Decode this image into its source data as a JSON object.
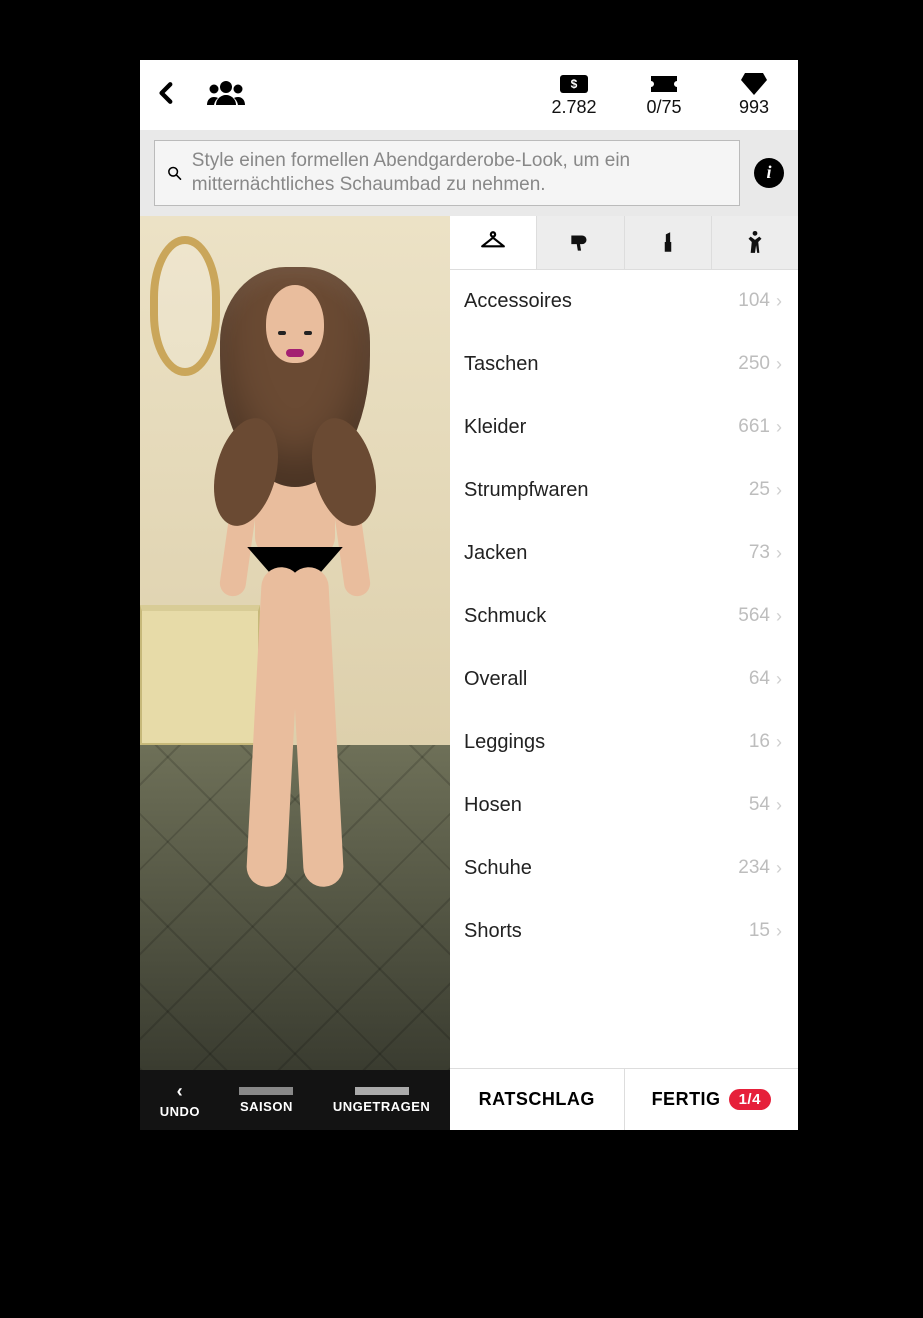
{
  "topbar": {
    "cash": "2.782",
    "tickets": "0/75",
    "gems": "993"
  },
  "challenge": {
    "text": "Style einen formellen Abendgarderobe-Look, um ein mitternächtliches Schaumbad zu nehmen."
  },
  "tabs": {
    "active_index": 0,
    "items": [
      "clothing",
      "hair",
      "makeup",
      "body"
    ]
  },
  "categories": [
    {
      "label": "Accessoires",
      "count": "104"
    },
    {
      "label": "Taschen",
      "count": "250"
    },
    {
      "label": "Kleider",
      "count": "661"
    },
    {
      "label": "Strumpfwaren",
      "count": "25"
    },
    {
      "label": "Jacken",
      "count": "73"
    },
    {
      "label": "Schmuck",
      "count": "564"
    },
    {
      "label": "Overall",
      "count": "64"
    },
    {
      "label": "Leggings",
      "count": "16"
    },
    {
      "label": "Hosen",
      "count": "54"
    },
    {
      "label": "Schuhe",
      "count": "234"
    },
    {
      "label": "Shorts",
      "count": "15"
    }
  ],
  "left_controls": {
    "undo": "UNDO",
    "season": "SAISON",
    "unworn": "UNGETRAGEN"
  },
  "bottom": {
    "advice": "RATSCHLAG",
    "done": "FERTIG",
    "done_badge": "1/4"
  }
}
